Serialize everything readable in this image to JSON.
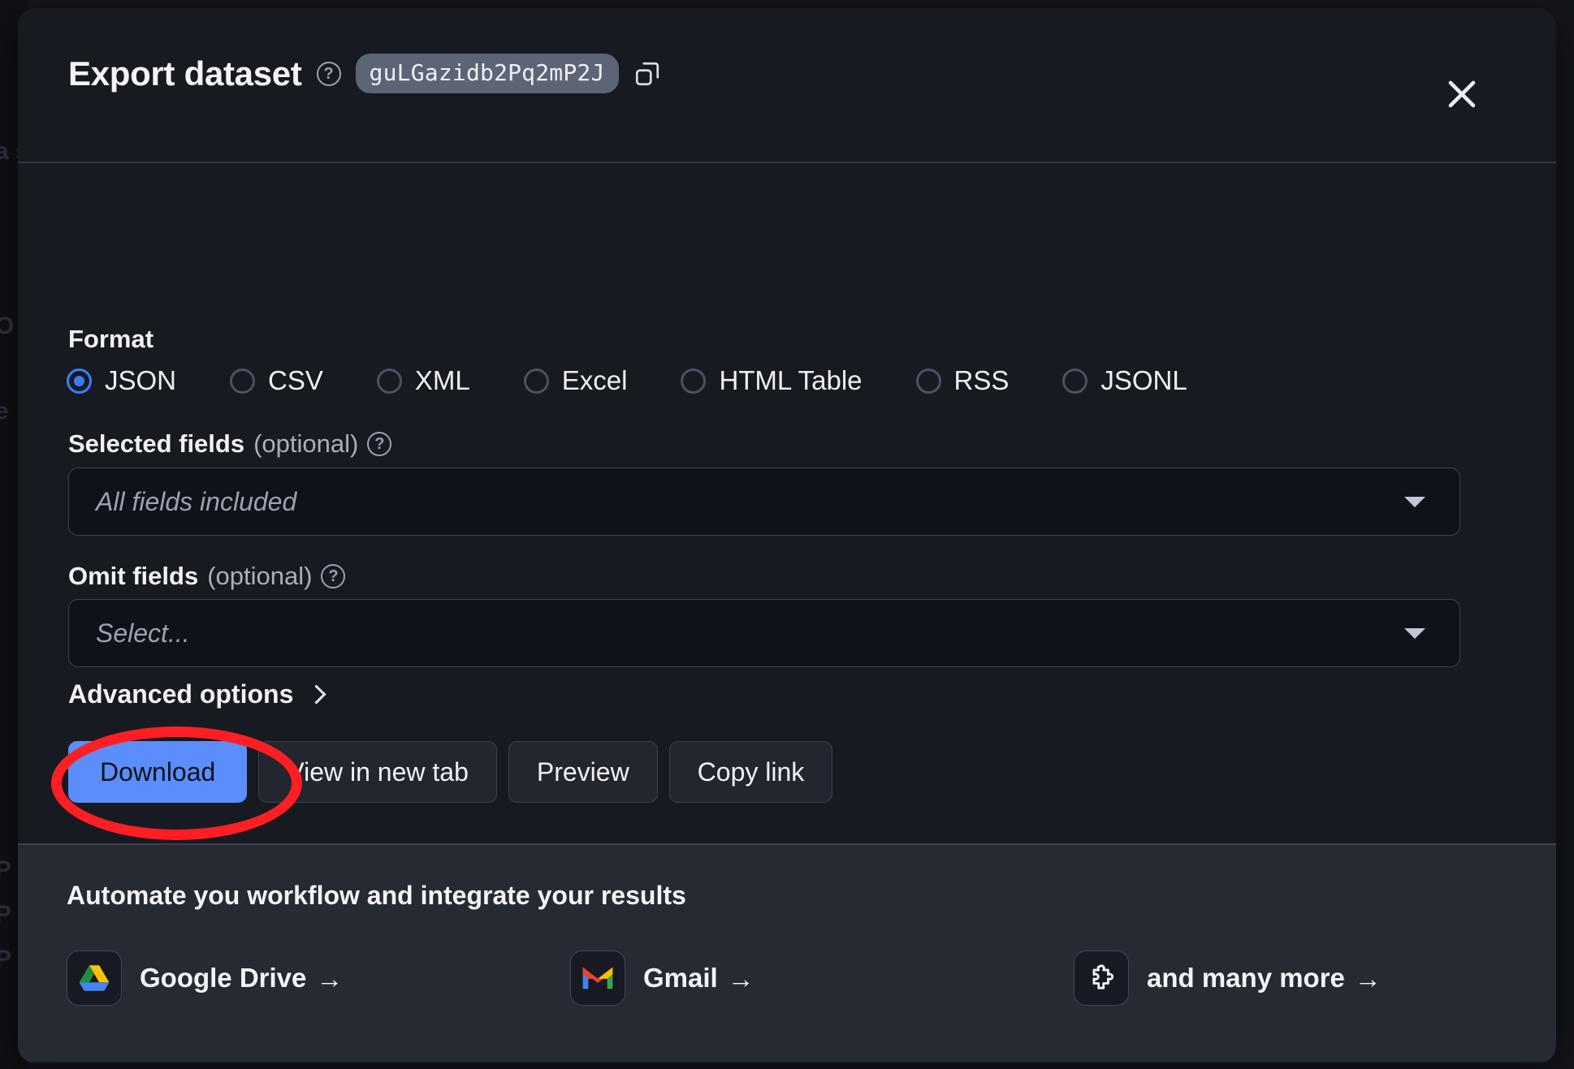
{
  "modal": {
    "title": "Export dataset",
    "help_icon": "question-mark-circle-icon",
    "dataset_id": "guLGazidb2Pq2mP2J",
    "copy_icon": "copy-icon",
    "close_icon": "close-x-icon"
  },
  "format": {
    "label": "Format",
    "selected": "JSON",
    "options": [
      {
        "label": "JSON",
        "checked": true
      },
      {
        "label": "CSV",
        "checked": false
      },
      {
        "label": "XML",
        "checked": false
      },
      {
        "label": "Excel",
        "checked": false
      },
      {
        "label": "HTML Table",
        "checked": false
      },
      {
        "label": "RSS",
        "checked": false
      },
      {
        "label": "JSONL",
        "checked": false
      }
    ]
  },
  "selected_fields": {
    "label": "Selected fields",
    "optional": "(optional)",
    "placeholder": "All fields included",
    "value": ""
  },
  "omit_fields": {
    "label": "Omit fields",
    "optional": "(optional)",
    "placeholder": "Select...",
    "value": ""
  },
  "advanced": {
    "label": "Advanced options",
    "chevron": "chevron-right-icon"
  },
  "actions": {
    "download": "Download",
    "view_in_new_tab": "View in new tab",
    "preview": "Preview",
    "copy_link": "Copy link"
  },
  "annotation": {
    "shape": "red-ellipse-highlight",
    "target": "Download",
    "color": "#fd1f23"
  },
  "footer": {
    "title": "Automate you workflow and integrate your results",
    "integrations": [
      {
        "label": "Google Drive",
        "arrow": "→",
        "icon": "google-drive-icon"
      },
      {
        "label": "Gmail",
        "arrow": "→",
        "icon": "gmail-icon"
      },
      {
        "label": "and many more",
        "arrow": "→",
        "icon": "puzzle-piece-icon"
      }
    ]
  },
  "colors": {
    "accent": "#5b8dfb",
    "radio_selected": "#3b7dfb",
    "modal_bg": "#181a22",
    "footer_bg": "#262a33",
    "annotation": "#fd1f23"
  },
  "background_hints": [
    "a s",
    "O",
    "e",
    "R",
    "P",
    "R"
  ]
}
